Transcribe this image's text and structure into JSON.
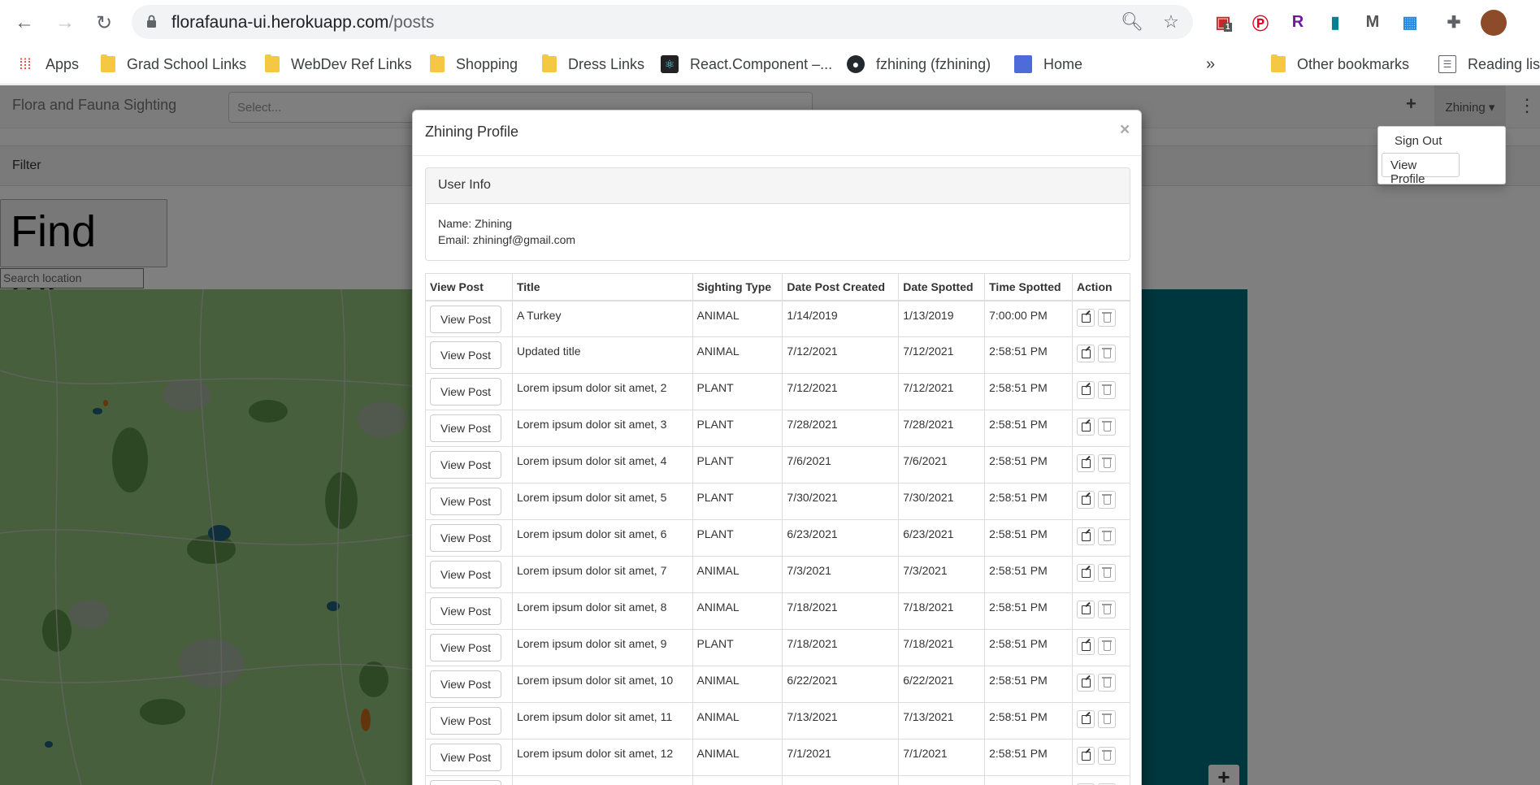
{
  "browser": {
    "url_host": "florafauna-ui.herokuapp.com",
    "url_path": "/posts",
    "bookmarks": [
      {
        "label": "Apps",
        "icon": "apps-grid-icon"
      },
      {
        "label": "Grad School Links",
        "icon": "folder-icon"
      },
      {
        "label": "WebDev Ref Links",
        "icon": "folder-icon"
      },
      {
        "label": "Shopping",
        "icon": "folder-icon"
      },
      {
        "label": "Dress Links",
        "icon": "folder-icon"
      },
      {
        "label": "React.Component –...",
        "icon": "react-icon"
      },
      {
        "label": "fzhining (fzhining)",
        "icon": "github-icon"
      },
      {
        "label": "Home",
        "icon": "page-icon"
      }
    ],
    "overflow": "»",
    "other_bookmarks": "Other bookmarks",
    "reading_list": "Reading list",
    "ext_badge": "1"
  },
  "navbar": {
    "brand": "Flora and Fauna Sighting",
    "select_placeholder": "Select...",
    "plus": "+",
    "user": "Zhining ▾",
    "kebab": "⋮"
  },
  "user_dropdown": {
    "sign_out": "Sign Out",
    "view_profile": "View Profile"
  },
  "filter": {
    "label": "Filter"
  },
  "map_controls": {
    "find_me": "Find me",
    "search_placeholder": "Search  location",
    "plus": "+"
  },
  "modal": {
    "title": "Zhining Profile",
    "close": "×",
    "panel_title": "User Info",
    "name_line": "Name: Zhining",
    "email_line": "Email: zhiningf@gmail.com",
    "columns": [
      "View Post",
      "Title",
      "Sighting Type",
      "Date Post Created",
      "Date Spotted",
      "Time Spotted",
      "Action"
    ],
    "view_post_label": "View Post",
    "rows": [
      {
        "title": "A Turkey",
        "type": "ANIMAL",
        "created": "1/14/2019",
        "spotted": "1/13/2019",
        "time": "7:00:00 PM"
      },
      {
        "title": "Updated title",
        "type": "ANIMAL",
        "created": "7/12/2021",
        "spotted": "7/12/2021",
        "time": "2:58:51 PM"
      },
      {
        "title": "Lorem ipsum dolor sit amet, 2",
        "type": "PLANT",
        "created": "7/12/2021",
        "spotted": "7/12/2021",
        "time": "2:58:51 PM"
      },
      {
        "title": "Lorem ipsum dolor sit amet, 3",
        "type": "PLANT",
        "created": "7/28/2021",
        "spotted": "7/28/2021",
        "time": "2:58:51 PM"
      },
      {
        "title": "Lorem ipsum dolor sit amet, 4",
        "type": "PLANT",
        "created": "7/6/2021",
        "spotted": "7/6/2021",
        "time": "2:58:51 PM"
      },
      {
        "title": "Lorem ipsum dolor sit amet, 5",
        "type": "PLANT",
        "created": "7/30/2021",
        "spotted": "7/30/2021",
        "time": "2:58:51 PM"
      },
      {
        "title": "Lorem ipsum dolor sit amet, 6",
        "type": "PLANT",
        "created": "6/23/2021",
        "spotted": "6/23/2021",
        "time": "2:58:51 PM"
      },
      {
        "title": "Lorem ipsum dolor sit amet, 7",
        "type": "ANIMAL",
        "created": "7/3/2021",
        "spotted": "7/3/2021",
        "time": "2:58:51 PM"
      },
      {
        "title": "Lorem ipsum dolor sit amet, 8",
        "type": "ANIMAL",
        "created": "7/18/2021",
        "spotted": "7/18/2021",
        "time": "2:58:51 PM"
      },
      {
        "title": "Lorem ipsum dolor sit amet, 9",
        "type": "PLANT",
        "created": "7/18/2021",
        "spotted": "7/18/2021",
        "time": "2:58:51 PM"
      },
      {
        "title": "Lorem ipsum dolor sit amet, 10",
        "type": "ANIMAL",
        "created": "6/22/2021",
        "spotted": "6/22/2021",
        "time": "2:58:51 PM"
      },
      {
        "title": "Lorem ipsum dolor sit amet, 11",
        "type": "ANIMAL",
        "created": "7/13/2021",
        "spotted": "7/13/2021",
        "time": "2:58:51 PM"
      },
      {
        "title": "Lorem ipsum dolor sit amet, 12",
        "type": "ANIMAL",
        "created": "7/1/2021",
        "spotted": "7/1/2021",
        "time": "2:58:51 PM"
      },
      {
        "title": "",
        "type": "",
        "created": "",
        "spotted": "",
        "time": ""
      }
    ]
  },
  "colors": {
    "map_green": "#8fbe7a",
    "map_teal": "#006d7a",
    "backdrop": "rgba(0,0,0,0.5)"
  }
}
